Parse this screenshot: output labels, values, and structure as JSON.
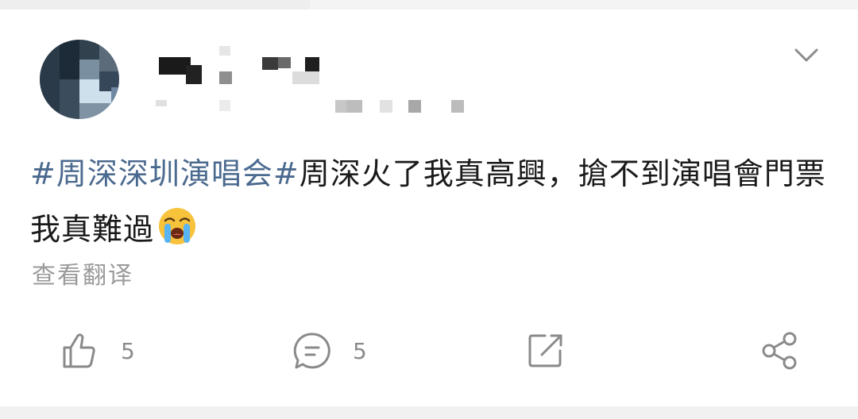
{
  "post": {
    "hashtag": "#周深深圳演唱会#",
    "text_after_hashtag": "周深火了我真高興，搶不到演唱會門票我真難過"
  },
  "translate_label": "查看翻译",
  "actions": {
    "like_count": "5",
    "comment_count": "5"
  },
  "icons": [
    "chevron-down-icon",
    "like-icon",
    "comment-icon",
    "repost-icon",
    "share-icon",
    "crying-face-emoji"
  ],
  "colors": {
    "hashtag": "#4b6a8f",
    "text": "#1a1a1a",
    "muted": "#9a9a9a",
    "icon": "#8a8a8a"
  }
}
